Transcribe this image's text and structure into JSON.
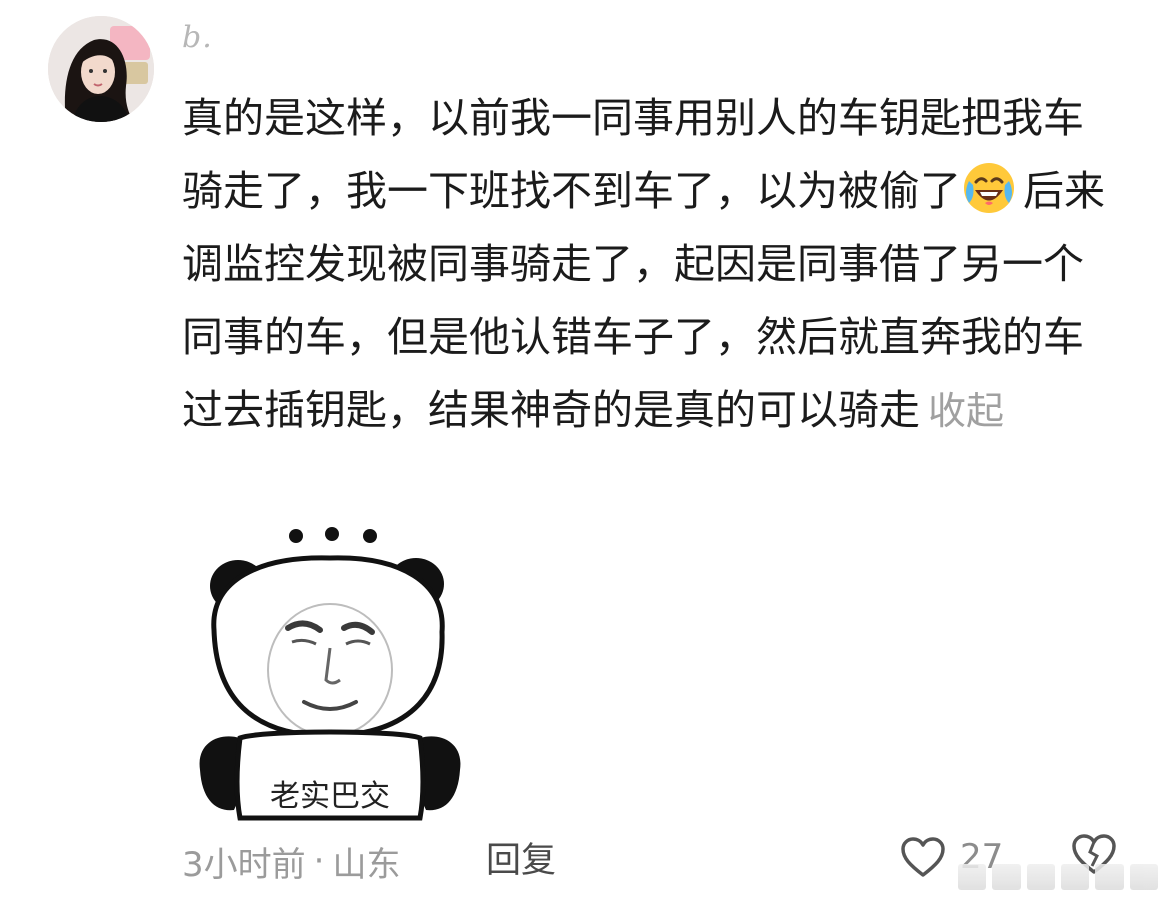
{
  "comment": {
    "username": "b.",
    "body": "真的是这样，以前我一同事用别人的车钥匙把我车骑走了，我一下班找不到车了，以为被偷了",
    "emoji": "face-with-tears-of-joy-icon",
    "body_continued": "后来调监控发现被同事骑走了，起因是同事借了另一个同事的车，但是他认错车子了，然后就直奔我的车过去插钥匙，结果神奇的是真的可以骑走",
    "collapse_label": "收起",
    "sticker": {
      "name": "panda-meme-sticker",
      "caption": "老实巴交"
    },
    "time": "3小时前",
    "separator": "·",
    "location": "山东",
    "reply_label": "回复",
    "like_count": "27"
  },
  "colors": {
    "text": "#1b1b1b",
    "muted": "#9b9b9b",
    "collapse": "#a0a0a0",
    "username": "#b7b7b7"
  }
}
